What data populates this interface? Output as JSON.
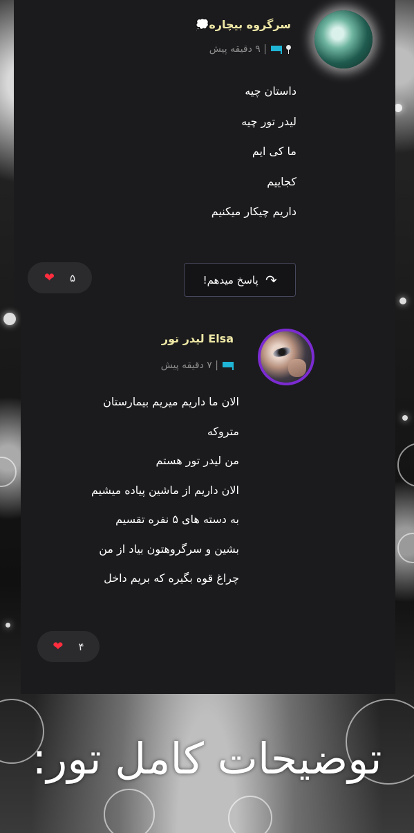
{
  "comments": [
    {
      "author": "سرگروه بیچاره",
      "author_icon": "thought-bubble-icon",
      "time": "| ۹ دقیقه پیش",
      "lines": [
        "داستان چیه",
        "لیدر تور چیه",
        "ما کی ایم",
        "کجاییم",
        "داریم چیکار میکنیم"
      ],
      "reply_label": "پاسخ میدهم!",
      "likes": "۵"
    },
    {
      "author": "Elsa لیدر تور",
      "time": "| ۷ دقیقه پیش",
      "lines": [
        "الان ما داریم میریم بیمارستان",
        "متروکه",
        "من لیدر تور هستم",
        "الان داریم از ماشین پیاده میشیم",
        "به دسته های ۵ نفره تقسیم",
        "بشین و سرگروهتون بیاد از من",
        "چراغ قوه بگیره که بریم داخل"
      ],
      "likes": "۴"
    }
  ],
  "footer_title": "توضیحات کامل تور:",
  "colors": {
    "author": "#efe8a6",
    "flag": "#1fb5d6",
    "heart": "#ff2d3d",
    "avatar_ring": "#7b2bd1"
  }
}
